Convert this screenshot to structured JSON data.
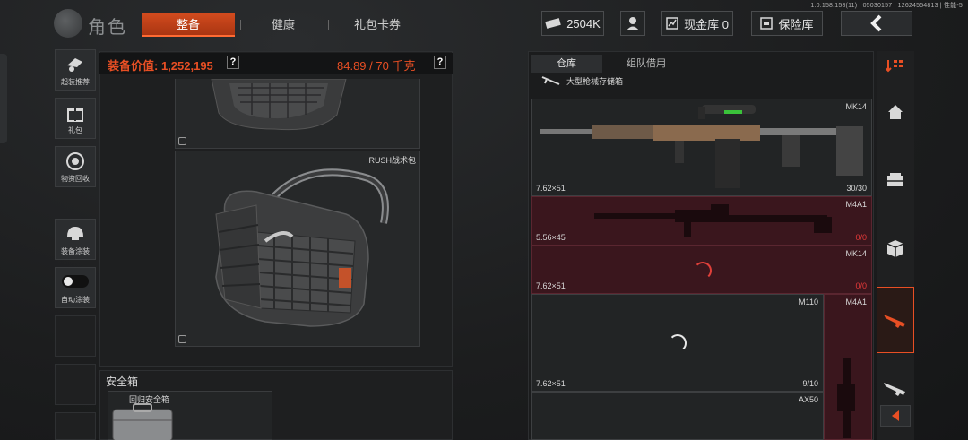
{
  "version_info": "1.0.158.158(11) | 05030157 | 12624554813 | 性能-5",
  "header": {
    "title": "角色",
    "tabs": [
      {
        "label": "整备",
        "active": true
      },
      {
        "label": "健康",
        "active": false
      },
      {
        "label": "礼包卡券",
        "active": false
      }
    ],
    "currency": "2504K",
    "cash_storage": "现金库 0",
    "insurance": "保险库"
  },
  "sidebar": {
    "items": [
      {
        "label": "起装推荐",
        "icon": "loadout-icon"
      },
      {
        "label": "礼包",
        "icon": "gift-icon"
      },
      {
        "label": "物资回收",
        "icon": "recycle-icon"
      },
      {
        "label": "装备涂装",
        "icon": "helmet-icon"
      },
      {
        "label": "自动涂装",
        "icon": "toggle-icon"
      }
    ]
  },
  "equipment": {
    "value_label": "装备价值: 1,252,195",
    "weight_label": "84.89 / 70 千克",
    "help": "?",
    "backpack_name": "RUSH战术包"
  },
  "safe_box": {
    "title": "安全箱",
    "item_name": "回归安全箱"
  },
  "warehouse": {
    "tabs": [
      {
        "label": "仓库",
        "active": true
      },
      {
        "label": "组队借用",
        "active": false
      }
    ],
    "subtitle": "大型枪械存储箱",
    "items": [
      {
        "name": "MK14",
        "ammo": "7.62×51",
        "count": "30/30",
        "state": "normal"
      },
      {
        "name": "M4A1",
        "ammo": "5.56×45",
        "count": "0/0",
        "state": "red"
      },
      {
        "name": "MK14",
        "ammo": "7.62×51",
        "count": "0/0",
        "state": "red"
      },
      {
        "name": "M110",
        "ammo": "7.62×51",
        "count": "9/10",
        "state": "normal"
      },
      {
        "name": "M4A1",
        "ammo": "",
        "count": "",
        "state": "red"
      },
      {
        "name": "AX50",
        "ammo": "",
        "count": "",
        "state": "normal"
      }
    ]
  },
  "rail": {
    "items": [
      "sort-icon",
      "home-icon",
      "crate-icon",
      "box-icon",
      "assault-rifle-icon",
      "rifle-icon"
    ],
    "active_index": 4
  },
  "colors": {
    "accent": "#e84f24",
    "locked_cell": "#3a161d",
    "count_empty": "#e63a3a"
  }
}
